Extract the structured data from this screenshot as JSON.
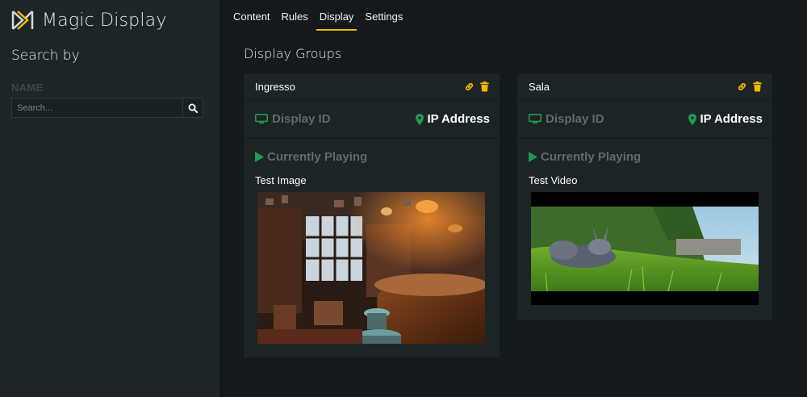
{
  "app": {
    "title": "Magic Display"
  },
  "sidebar": {
    "search_by": "Search by",
    "name_label": "NAME",
    "search_placeholder": "Search..."
  },
  "nav": {
    "tabs": [
      {
        "label": "Content",
        "active": false
      },
      {
        "label": "Rules",
        "active": false
      },
      {
        "label": "Display",
        "active": true
      },
      {
        "label": "Settings",
        "active": false
      }
    ]
  },
  "main": {
    "section_title": "Display Groups",
    "groups": [
      {
        "name": "Ingresso",
        "display_id_label": "Display ID",
        "ip_label": "IP Address",
        "playing_label": "Currently Playing",
        "media_title": "Test Image",
        "media_type": "image"
      },
      {
        "name": "Sala",
        "display_id_label": "Display ID",
        "ip_label": "IP Address",
        "playing_label": "Currently Playing",
        "media_title": "Test Video",
        "media_type": "video"
      }
    ]
  },
  "colors": {
    "accent": "#f1b900",
    "green": "#1f9d4e",
    "sidebar_bg": "#1d2526",
    "page_bg": "#141a1b"
  }
}
